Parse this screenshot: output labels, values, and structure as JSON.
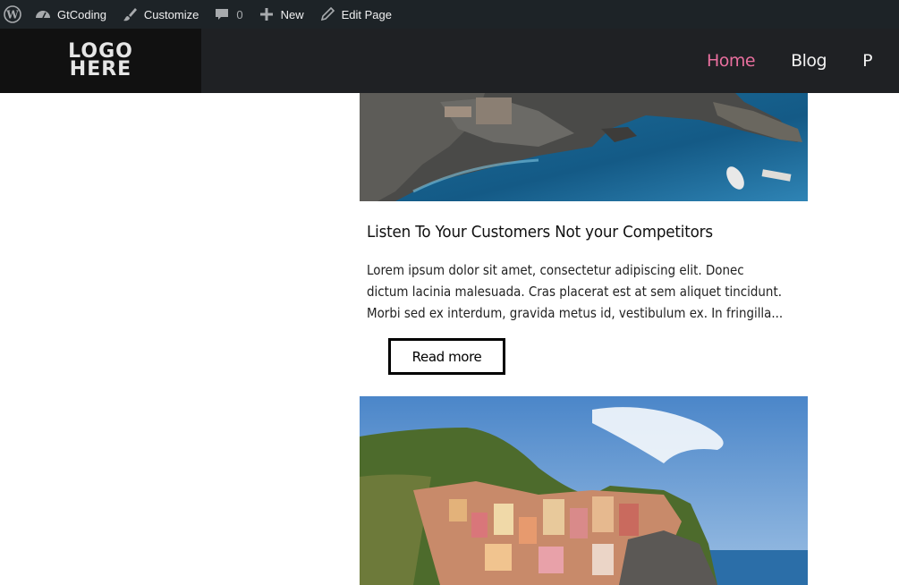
{
  "admin_bar": {
    "items": [
      {
        "icon": "wordpress-logo-icon",
        "label": ""
      },
      {
        "icon": "dashboard-icon",
        "label": "GtCoding"
      },
      {
        "icon": "paintbrush-icon",
        "label": "Customize"
      },
      {
        "icon": "comment-icon",
        "label": "0"
      },
      {
        "icon": "plus-icon",
        "label": "New"
      },
      {
        "icon": "pencil-icon",
        "label": "Edit Page"
      }
    ]
  },
  "header": {
    "logo_line1": "LOGO",
    "logo_line2": "HERE",
    "nav": [
      {
        "label": "Home",
        "active": true
      },
      {
        "label": "Blog",
        "active": false
      },
      {
        "label": "P",
        "active": false
      }
    ],
    "accent_color": "#e86f9e"
  },
  "posts": [
    {
      "image": "coastal-cove-with-boats",
      "title": "Listen To Your Customers Not your Competitors",
      "excerpt_lines": [
        "Lorem ipsum dolor sit amet, consectetur adipiscing elit. Donec",
        "dictum lacinia malesuada. Cras placerat est at sem aliquet tincidunt.",
        "Morbi sed ex interdum, gravida metus id, vestibulum ex. In fringilla..."
      ],
      "read_more_label": "Read more"
    },
    {
      "image": "cliffside-village-by-sea"
    }
  ]
}
